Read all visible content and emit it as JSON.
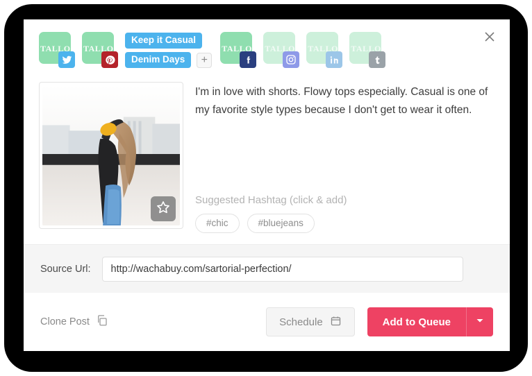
{
  "dialog": {
    "close_icon": "close-icon"
  },
  "accounts": [
    {
      "network": "twitter",
      "watermark": "TALLO",
      "active": true,
      "color": "#4cb3ed",
      "icon": "twitter-icon"
    },
    {
      "network": "pinterest",
      "watermark": "TALLO",
      "active": true,
      "color": "#b4232a",
      "icon": "pinterest-icon"
    },
    {
      "network": "facebook",
      "watermark": "TALLO",
      "active": true,
      "color": "#2a3f7f",
      "icon": "facebook-icon"
    },
    {
      "network": "instagram",
      "watermark": "TALLO",
      "active": false,
      "color": "#8e9ae8",
      "icon": "instagram-icon"
    },
    {
      "network": "linkedin",
      "watermark": "TALLO",
      "active": false,
      "color": "#9cc6e8",
      "icon": "linkedin-icon"
    },
    {
      "network": "tumblr",
      "watermark": "TALLO",
      "active": false,
      "color": "#9aa2a8",
      "icon": "tumblr-icon"
    }
  ],
  "tags": {
    "items": [
      "Keep it Casual",
      "Denim Days"
    ],
    "add_label": "+",
    "pill_color": "#4cb3ed"
  },
  "post": {
    "text": "I'm in love with shorts. Flowy tops especially. Casual is one of my favorite style types because I don't get to wear it often.",
    "image_alt": "woman on rooftop wearing black top and blue jeans",
    "favorite_icon": "star-icon"
  },
  "hashtags": {
    "label": "Suggested Hashtag (click & add)",
    "items": [
      "#chic",
      "#bluejeans"
    ]
  },
  "source_url": {
    "label": "Source Url:",
    "value": "http://wachabuy.com/sartorial-perfection/",
    "placeholder": "http://"
  },
  "footer": {
    "clone_label": "Clone Post",
    "clone_icon": "copy-icon",
    "schedule_label": "Schedule",
    "schedule_icon": "calendar-icon",
    "queue_label": "Add to Queue",
    "queue_caret_icon": "chevron-down-icon",
    "queue_color": "#ee4263"
  }
}
